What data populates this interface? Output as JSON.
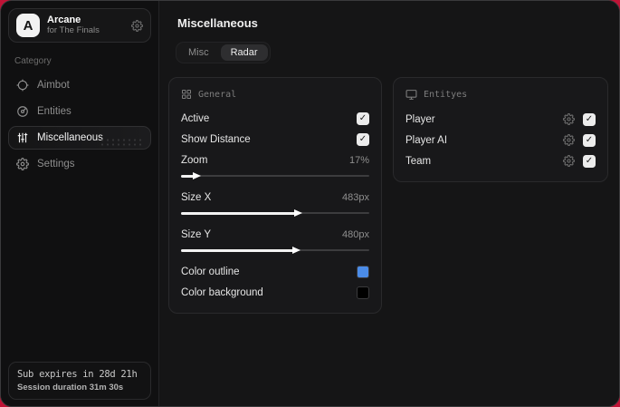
{
  "accent_color": "#c01336",
  "app": {
    "name": "Arcane",
    "subtitle": "for The Finals"
  },
  "sidebar": {
    "category_label": "Category",
    "items": [
      {
        "label": "Aimbot",
        "icon": "crosshair-icon",
        "selected": false
      },
      {
        "label": "Entities",
        "icon": "entities-icon",
        "selected": false
      },
      {
        "label": "Miscellaneous",
        "icon": "sliders-icon",
        "selected": true
      },
      {
        "label": "Settings",
        "icon": "gear-icon",
        "selected": false
      }
    ],
    "footer": {
      "sub_line": "Sub expires in 28d 21h",
      "session_line": "Session duration 31m 30s"
    }
  },
  "main": {
    "title": "Miscellaneous",
    "tabs": [
      {
        "label": "Misc",
        "active": false
      },
      {
        "label": "Radar",
        "active": true
      }
    ],
    "general_card": {
      "title": "General",
      "toggles": [
        {
          "label": "Active",
          "checked": true
        },
        {
          "label": "Show Distance",
          "checked": true
        }
      ],
      "sliders": [
        {
          "label": "Zoom",
          "value": "17%",
          "fill_pct": 7
        },
        {
          "label": "Size X",
          "value": "483px",
          "fill_pct": 61
        },
        {
          "label": "Size Y",
          "value": "480px",
          "fill_pct": 60
        }
      ],
      "colors": [
        {
          "label": "Color outline",
          "swatch": "#4b8ce8"
        },
        {
          "label": "Color background",
          "swatch": "#000000"
        }
      ]
    },
    "entities_card": {
      "title": "Entityes",
      "rows": [
        {
          "label": "Player",
          "checked": true
        },
        {
          "label": "Player AI",
          "checked": true
        },
        {
          "label": "Team",
          "checked": true
        }
      ]
    }
  }
}
